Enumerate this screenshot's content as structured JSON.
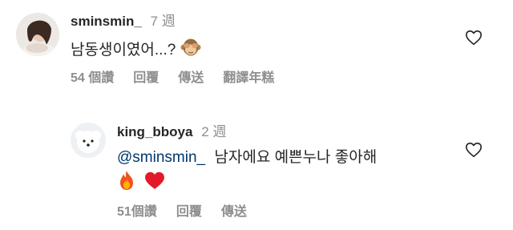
{
  "comments": [
    {
      "username": "sminsmin_",
      "time": "7 週",
      "text": "남동생이였어...?",
      "emoji": "see-no-evil-monkey",
      "actions": [
        "54 個讚",
        "回覆",
        "傳送",
        "翻譯年糕"
      ],
      "avatar": "user-photo"
    },
    {
      "username": "king_bboya",
      "time": "2 週",
      "mention": "@sminsmin_",
      "text": "남자에요 예쁜누나 좋아해",
      "emojis": [
        "fire",
        "red-heart"
      ],
      "actions": [
        "51個讚",
        "回覆",
        "傳送"
      ],
      "avatar": "white-dog-photo"
    }
  ],
  "colors": {
    "text": "#262626",
    "secondary": "#8e8e8e",
    "mention": "#00376b"
  }
}
